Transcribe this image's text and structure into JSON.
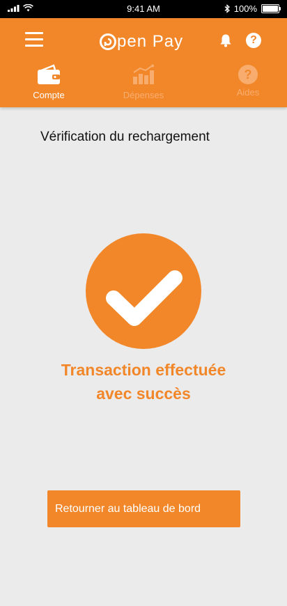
{
  "status_bar": {
    "time": "9:41 AM",
    "battery": "100%"
  },
  "header": {
    "logo_text": "pen Pay",
    "tabs": [
      {
        "label": "Compte",
        "icon": "wallet-icon",
        "active": true
      },
      {
        "label": "Dépenses",
        "icon": "bar-chart-icon",
        "active": false
      },
      {
        "label": "Aides",
        "icon": "help-circle-icon",
        "active": false
      }
    ]
  },
  "page": {
    "title": "Vérification du rechargement",
    "success_line1": "Transaction effectuée",
    "success_line2": "avec succès",
    "back_button": "Retourner au tableau de bord"
  },
  "colors": {
    "accent": "#f2872a",
    "background": "#ebebeb"
  }
}
